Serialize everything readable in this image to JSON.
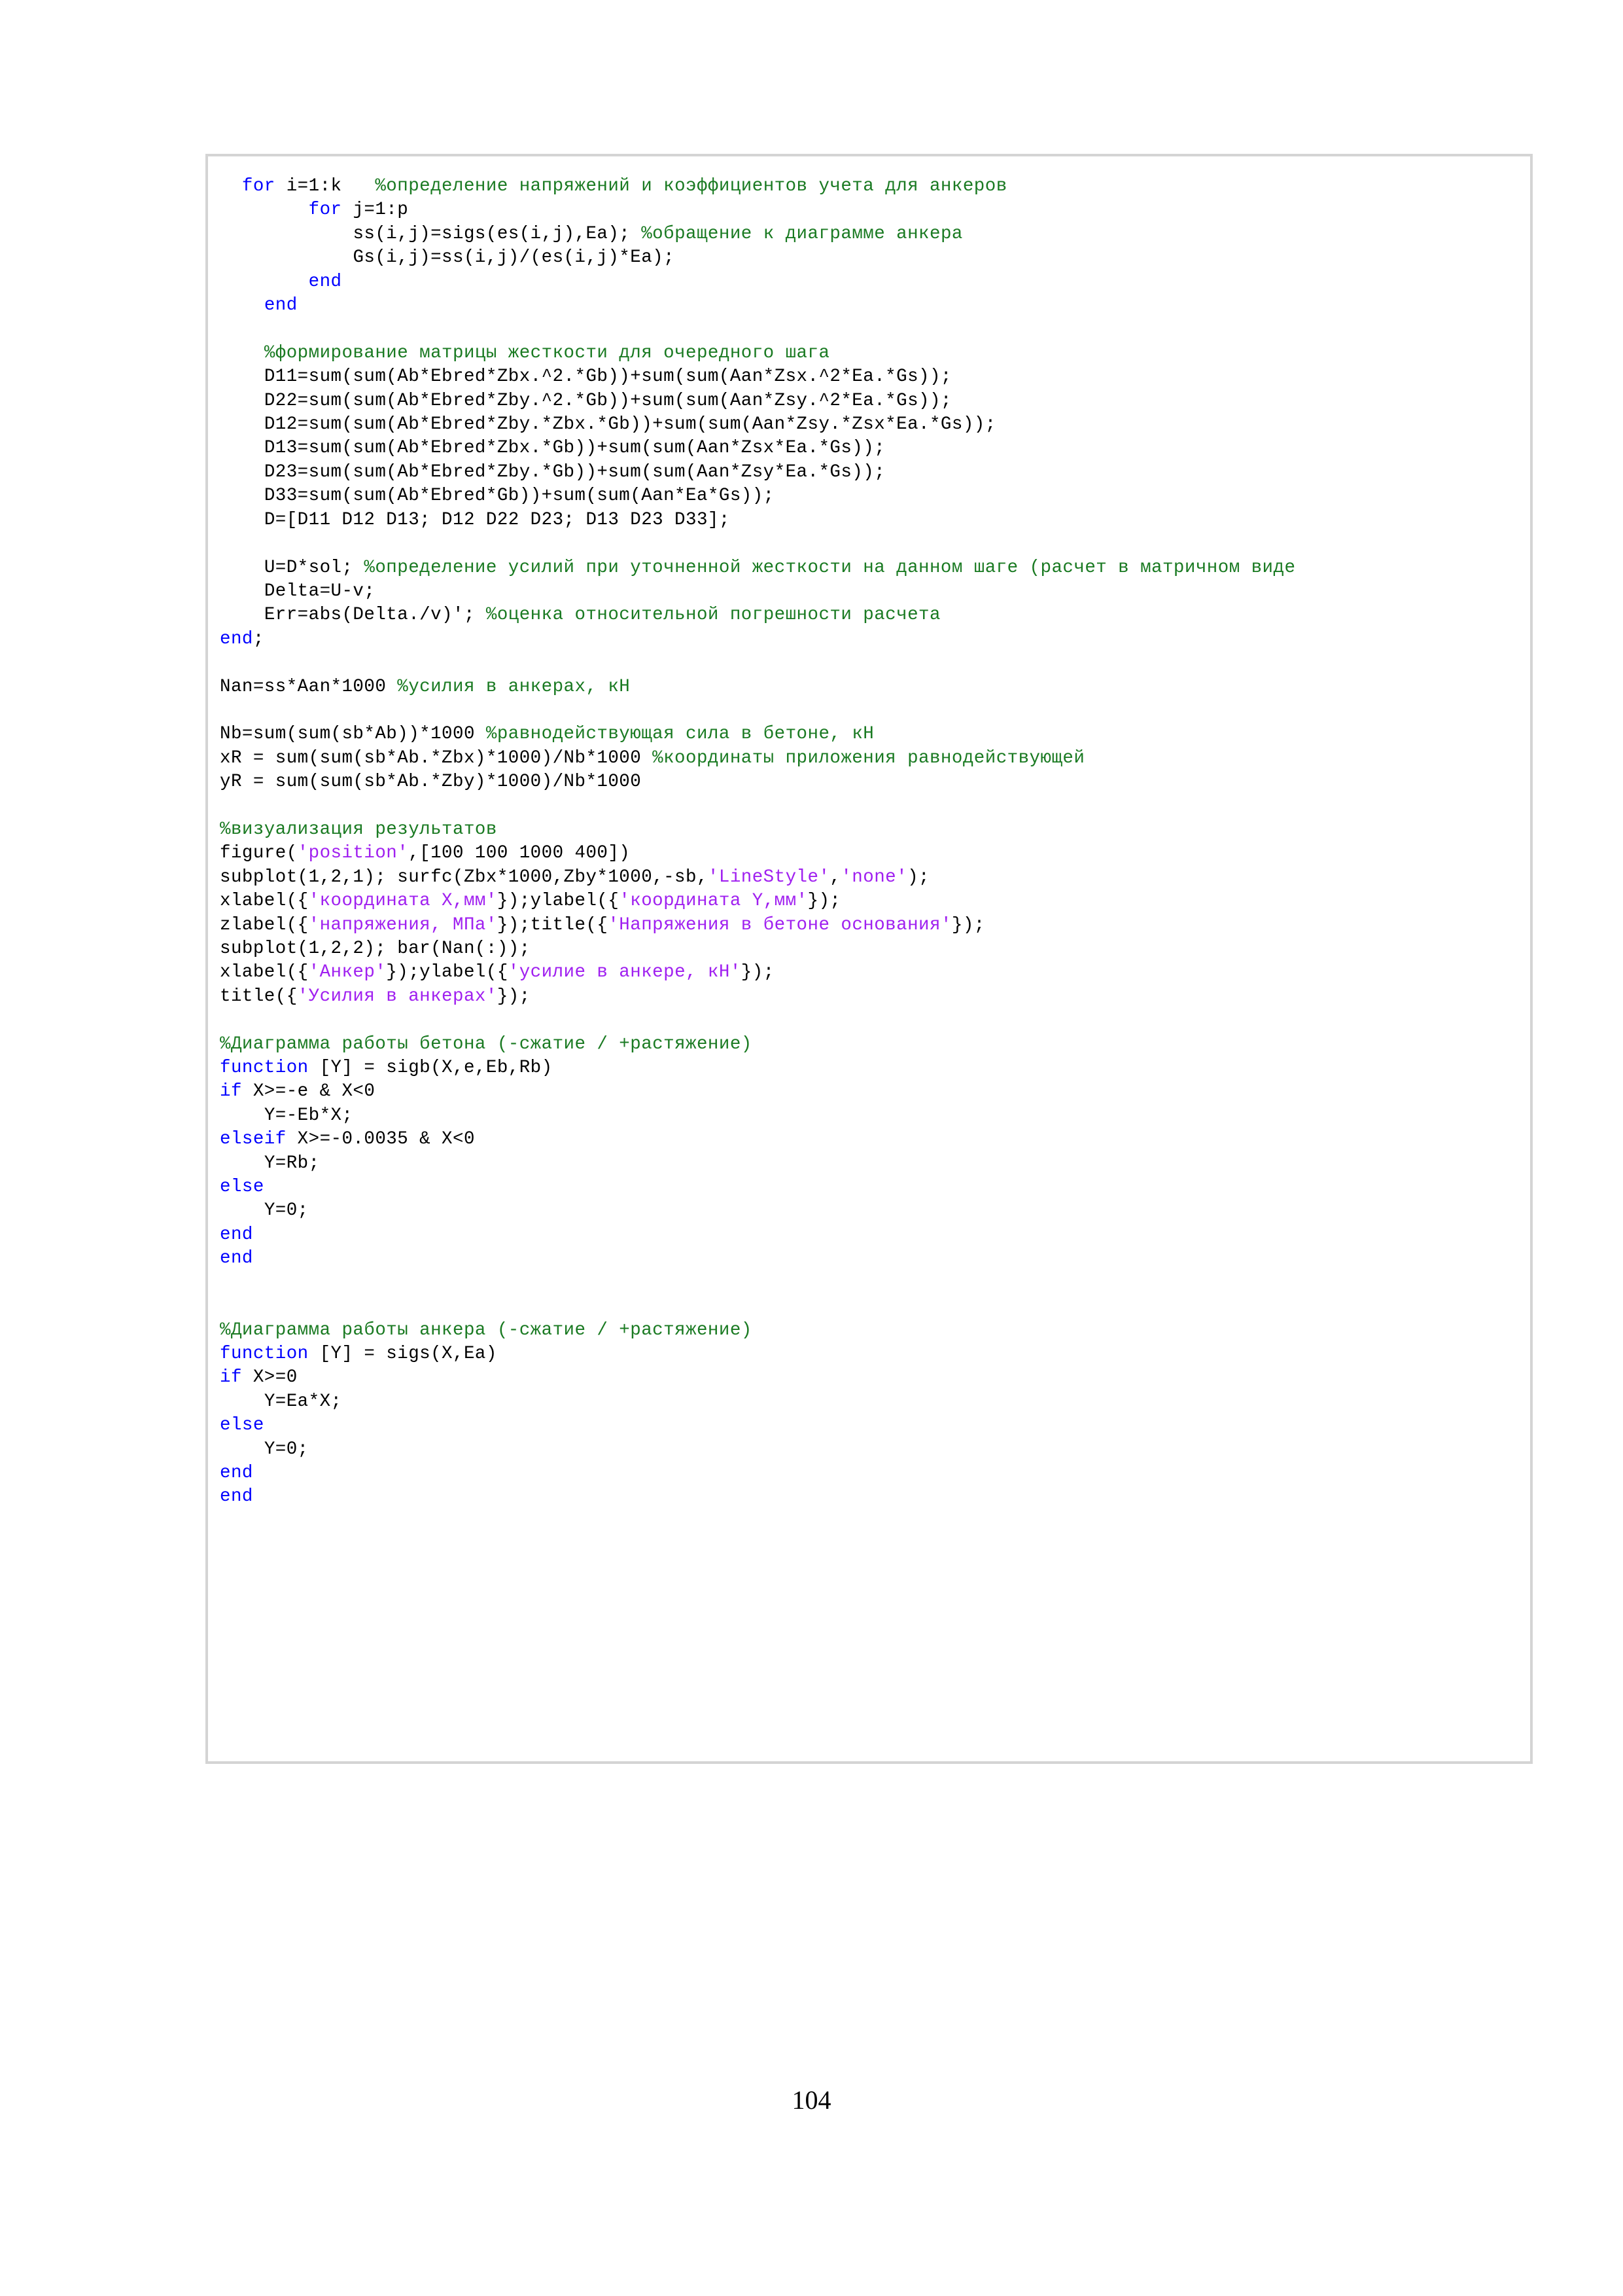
{
  "document": {
    "page_number": "104",
    "language": "MATLAB"
  },
  "colors": {
    "keyword": "#0000FF",
    "comment": "#1A7A22",
    "string": "#A020F0",
    "plain": "#000000",
    "block_border": "#D4D4D4",
    "page_background": "#FFFFFF"
  },
  "code_block": {
    "lines": [
      {
        "indent": 0,
        "tokens": [
          {
            "t": "pln",
            "v": "  "
          },
          {
            "t": "kw",
            "v": "for"
          },
          {
            "t": "pln",
            "v": " i=1:k   "
          },
          {
            "t": "cmt",
            "v": "%определение напряжений и коэффициентов учета для анкеров"
          }
        ]
      },
      {
        "indent": 0,
        "tokens": [
          {
            "t": "pln",
            "v": "        "
          },
          {
            "t": "kw",
            "v": "for"
          },
          {
            "t": "pln",
            "v": " j=1:p"
          }
        ]
      },
      {
        "indent": 0,
        "tokens": [
          {
            "t": "pln",
            "v": "            ss(i,j)=sigs(es(i,j),Ea); "
          },
          {
            "t": "cmt",
            "v": "%обращение к диаграмме анкера"
          }
        ]
      },
      {
        "indent": 0,
        "tokens": [
          {
            "t": "pln",
            "v": "            Gs(i,j)=ss(i,j)/(es(i,j)*Ea);"
          }
        ]
      },
      {
        "indent": 0,
        "tokens": [
          {
            "t": "pln",
            "v": "        "
          },
          {
            "t": "kw",
            "v": "end"
          }
        ]
      },
      {
        "indent": 0,
        "tokens": [
          {
            "t": "pln",
            "v": "    "
          },
          {
            "t": "kw",
            "v": "end"
          }
        ]
      },
      {
        "indent": 0,
        "tokens": []
      },
      {
        "indent": 0,
        "tokens": [
          {
            "t": "pln",
            "v": "    "
          },
          {
            "t": "cmt",
            "v": "%формирование матрицы жесткости для очередного шага"
          }
        ]
      },
      {
        "indent": 0,
        "tokens": [
          {
            "t": "pln",
            "v": "    D11=sum(sum(Ab*Ebred*Zbx.^2.*Gb))+sum(sum(Aan*Zsx.^2*Ea.*Gs));"
          }
        ]
      },
      {
        "indent": 0,
        "tokens": [
          {
            "t": "pln",
            "v": "    D22=sum(sum(Ab*Ebred*Zby.^2.*Gb))+sum(sum(Aan*Zsy.^2*Ea.*Gs));"
          }
        ]
      },
      {
        "indent": 0,
        "tokens": [
          {
            "t": "pln",
            "v": "    D12=sum(sum(Ab*Ebred*Zby.*Zbx.*Gb))+sum(sum(Aan*Zsy.*Zsx*Ea.*Gs));"
          }
        ]
      },
      {
        "indent": 0,
        "tokens": [
          {
            "t": "pln",
            "v": "    D13=sum(sum(Ab*Ebred*Zbx.*Gb))+sum(sum(Aan*Zsx*Ea.*Gs));"
          }
        ]
      },
      {
        "indent": 0,
        "tokens": [
          {
            "t": "pln",
            "v": "    D23=sum(sum(Ab*Ebred*Zby.*Gb))+sum(sum(Aan*Zsy*Ea.*Gs));"
          }
        ]
      },
      {
        "indent": 0,
        "tokens": [
          {
            "t": "pln",
            "v": "    D33=sum(sum(Ab*Ebred*Gb))+sum(sum(Aan*Ea*Gs));"
          }
        ]
      },
      {
        "indent": 0,
        "tokens": [
          {
            "t": "pln",
            "v": "    D=[D11 D12 D13; D12 D22 D23; D13 D23 D33];"
          }
        ]
      },
      {
        "indent": 0,
        "tokens": []
      },
      {
        "indent": 0,
        "tokens": [
          {
            "t": "pln",
            "v": "    U=D*sol; "
          },
          {
            "t": "cmt",
            "v": "%определение усилий при уточненной жесткости на данном шаге (расчет в матричном виде"
          }
        ]
      },
      {
        "indent": 0,
        "tokens": [
          {
            "t": "pln",
            "v": "    Delta=U-v;"
          }
        ]
      },
      {
        "indent": 0,
        "tokens": [
          {
            "t": "pln",
            "v": "    Err=abs(Delta./v)'; "
          },
          {
            "t": "cmt",
            "v": "%оценка относительной погрешности расчета"
          }
        ]
      },
      {
        "indent": 0,
        "tokens": [
          {
            "t": "kw",
            "v": "end"
          },
          {
            "t": "pln",
            "v": ";"
          }
        ]
      },
      {
        "indent": 0,
        "tokens": []
      },
      {
        "indent": 0,
        "tokens": [
          {
            "t": "pln",
            "v": "Nan=ss*Aan*1000 "
          },
          {
            "t": "cmt",
            "v": "%усилия в анкерах, кН"
          }
        ]
      },
      {
        "indent": 0,
        "tokens": []
      },
      {
        "indent": 0,
        "tokens": [
          {
            "t": "pln",
            "v": "Nb=sum(sum(sb*Ab))*1000 "
          },
          {
            "t": "cmt",
            "v": "%равнодействующая сила в бетоне, кН"
          }
        ]
      },
      {
        "indent": 0,
        "tokens": [
          {
            "t": "pln",
            "v": "xR = sum(sum(sb*Ab.*Zbx)*1000)/Nb*1000 "
          },
          {
            "t": "cmt",
            "v": "%координаты приложения равнодействующей"
          }
        ]
      },
      {
        "indent": 0,
        "tokens": [
          {
            "t": "pln",
            "v": "yR = sum(sum(sb*Ab.*Zby)*1000)/Nb*1000"
          }
        ]
      },
      {
        "indent": 0,
        "tokens": []
      },
      {
        "indent": 0,
        "tokens": [
          {
            "t": "cmt",
            "v": "%визуализация результатов"
          }
        ]
      },
      {
        "indent": 0,
        "tokens": [
          {
            "t": "pln",
            "v": "figure("
          },
          {
            "t": "str",
            "v": "'position'"
          },
          {
            "t": "pln",
            "v": ",[100 100 1000 400])"
          }
        ]
      },
      {
        "indent": 0,
        "tokens": [
          {
            "t": "pln",
            "v": "subplot(1,2,1); surfc(Zbx*1000,Zby*1000,-sb,"
          },
          {
            "t": "str",
            "v": "'LineStyle'"
          },
          {
            "t": "pln",
            "v": ","
          },
          {
            "t": "str",
            "v": "'none'"
          },
          {
            "t": "pln",
            "v": ");"
          }
        ]
      },
      {
        "indent": 0,
        "tokens": [
          {
            "t": "pln",
            "v": "xlabel({"
          },
          {
            "t": "str",
            "v": "'координата X,мм'"
          },
          {
            "t": "pln",
            "v": "});ylabel({"
          },
          {
            "t": "str",
            "v": "'координата Y,мм'"
          },
          {
            "t": "pln",
            "v": "});"
          }
        ]
      },
      {
        "indent": 0,
        "tokens": [
          {
            "t": "pln",
            "v": "zlabel({"
          },
          {
            "t": "str",
            "v": "'напряжения, МПа'"
          },
          {
            "t": "pln",
            "v": "});title({"
          },
          {
            "t": "str",
            "v": "'Напряжения в бетоне основания'"
          },
          {
            "t": "pln",
            "v": "});"
          }
        ]
      },
      {
        "indent": 0,
        "tokens": [
          {
            "t": "pln",
            "v": "subplot(1,2,2); bar(Nan(:));"
          }
        ]
      },
      {
        "indent": 0,
        "tokens": [
          {
            "t": "pln",
            "v": "xlabel({"
          },
          {
            "t": "str",
            "v": "'Анкер'"
          },
          {
            "t": "pln",
            "v": "});ylabel({"
          },
          {
            "t": "str",
            "v": "'усилие в анкере, кН'"
          },
          {
            "t": "pln",
            "v": "});"
          }
        ]
      },
      {
        "indent": 0,
        "tokens": [
          {
            "t": "pln",
            "v": "title({"
          },
          {
            "t": "str",
            "v": "'Усилия в анкерах'"
          },
          {
            "t": "pln",
            "v": "});"
          }
        ]
      },
      {
        "indent": 0,
        "tokens": []
      },
      {
        "indent": 0,
        "tokens": [
          {
            "t": "cmt",
            "v": "%Диаграмма работы бетона (-сжатие / +растяжение)"
          }
        ]
      },
      {
        "indent": 0,
        "tokens": [
          {
            "t": "kw",
            "v": "function"
          },
          {
            "t": "pln",
            "v": " [Y] = sigb(X,e,Eb,Rb)"
          }
        ]
      },
      {
        "indent": 0,
        "tokens": [
          {
            "t": "kw",
            "v": "if"
          },
          {
            "t": "pln",
            "v": " X>=-e & X<0"
          }
        ]
      },
      {
        "indent": 0,
        "tokens": [
          {
            "t": "pln",
            "v": "    Y=-Eb*X;"
          }
        ]
      },
      {
        "indent": 0,
        "tokens": [
          {
            "t": "kw",
            "v": "elseif"
          },
          {
            "t": "pln",
            "v": " X>=-0.0035 & X<0"
          }
        ]
      },
      {
        "indent": 0,
        "tokens": [
          {
            "t": "pln",
            "v": "    Y=Rb;"
          }
        ]
      },
      {
        "indent": 0,
        "tokens": [
          {
            "t": "kw",
            "v": "else"
          }
        ]
      },
      {
        "indent": 0,
        "tokens": [
          {
            "t": "pln",
            "v": "    Y=0;"
          }
        ]
      },
      {
        "indent": 0,
        "tokens": [
          {
            "t": "kw",
            "v": "end"
          }
        ]
      },
      {
        "indent": 0,
        "tokens": [
          {
            "t": "kw",
            "v": "end"
          }
        ]
      },
      {
        "indent": 0,
        "tokens": []
      },
      {
        "indent": 0,
        "tokens": []
      },
      {
        "indent": 0,
        "tokens": [
          {
            "t": "cmt",
            "v": "%Диаграмма работы анкера (-сжатие / +растяжение)"
          }
        ]
      },
      {
        "indent": 0,
        "tokens": [
          {
            "t": "kw",
            "v": "function"
          },
          {
            "t": "pln",
            "v": " [Y] = sigs(X,Ea)"
          }
        ]
      },
      {
        "indent": 0,
        "tokens": [
          {
            "t": "kw",
            "v": "if"
          },
          {
            "t": "pln",
            "v": " X>=0"
          }
        ]
      },
      {
        "indent": 0,
        "tokens": [
          {
            "t": "pln",
            "v": "    Y=Ea*X;"
          }
        ]
      },
      {
        "indent": 0,
        "tokens": [
          {
            "t": "kw",
            "v": "else"
          }
        ]
      },
      {
        "indent": 0,
        "tokens": [
          {
            "t": "pln",
            "v": "    Y=0;"
          }
        ]
      },
      {
        "indent": 0,
        "tokens": [
          {
            "t": "kw",
            "v": "end"
          }
        ]
      },
      {
        "indent": 0,
        "tokens": [
          {
            "t": "kw",
            "v": "end"
          }
        ]
      }
    ]
  }
}
